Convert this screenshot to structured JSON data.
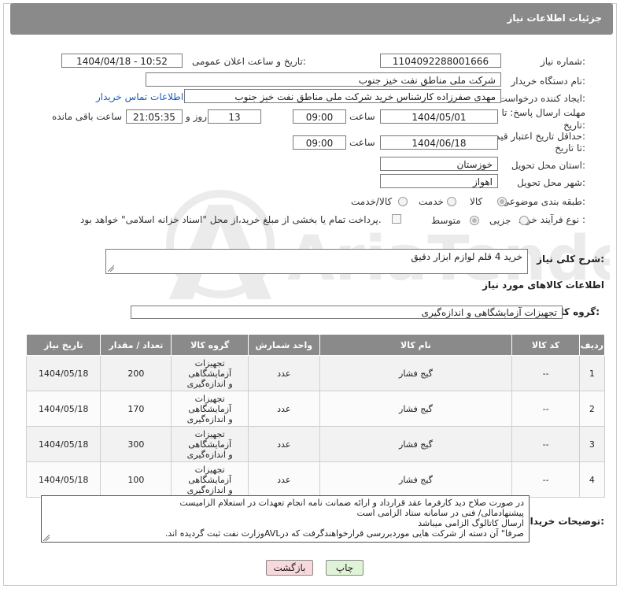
{
  "header": {
    "title": "جزئیات اطلاعات نیاز"
  },
  "fields": {
    "need_number_label": "شماره نیاز:",
    "need_number": "1104092288001666",
    "announce_label": "تاریخ و ساعت اعلان عمومی:",
    "announce_value": "1404/04/18 - 10:52",
    "buyer_org_label": "نام دستگاه خریدار:",
    "buyer_org": "شرکت ملی مناطق نفت خیز جنوب",
    "creator_label": "ایجاد کننده درخواست:",
    "creator": "مهدی صفرزاده کارشناس خرید شرکت ملی مناطق نفت خیز جنوب",
    "contact_link": "اطلاعات تماس خریدار",
    "deadline_label_1": "مهلت ارسال پاسخ: تا",
    "deadline_label_2": "تاریخ:",
    "deadline_date": "1404/05/01",
    "time_label": "ساعت",
    "deadline_time": "09:00",
    "days_value": "13",
    "days_label": "روز و",
    "remaining_time": "21:05:35",
    "remaining_label": "ساعت باقی مانده",
    "validity_label_1": "حداقل تاریخ اعتبار قیمت:",
    "validity_label_2": "تا تاریخ:",
    "validity_date": "1404/06/18",
    "validity_time": "09:00",
    "province_label": "استان محل تحویل:",
    "province": "خوزستان",
    "city_label": "شهر محل تحویل:",
    "city": "اهواز",
    "category_label": "طبقه بندی موضوعی:",
    "category_options": [
      "کالا",
      "خدمت",
      "کالا/خدمت"
    ],
    "process_label": "نوع فرآیند خرید :",
    "process_options": [
      "جزیی",
      "متوسط"
    ],
    "payment_note": "پرداخت تمام یا بخشی از مبلغ خرید،از محل \"اسناد خزانه اسلامی\" خواهد بود.",
    "description_label": "شرح کلی نیاز:",
    "description": "خرید 4 قلم لوازم ابزار دقیق",
    "goods_info_title": "اطلاعات کالاهای مورد نیاز",
    "goods_group_label": "گروه کالا:",
    "goods_group": "تجهیزات آزمایشگاهی و اندازه‌گیری"
  },
  "table": {
    "headers": [
      "ردیف",
      "کد کالا",
      "نام کالا",
      "واحد شمارش",
      "گروه کالا",
      "تعداد / مقدار",
      "تاریخ نیاز"
    ],
    "rows": [
      [
        "1",
        "--",
        "گیج فشار",
        "عدد",
        "تجهیزات آزمایشگاهی و اندازه‌گیری",
        "200",
        "1404/05/18"
      ],
      [
        "2",
        "--",
        "گیج فشار",
        "عدد",
        "تجهیزات آزمایشگاهی و اندازه‌گیری",
        "170",
        "1404/05/18"
      ],
      [
        "3",
        "--",
        "گیج فشار",
        "عدد",
        "تجهیزات آزمایشگاهی و اندازه‌گیری",
        "300",
        "1404/05/18"
      ],
      [
        "4",
        "--",
        "گیج فشار",
        "عدد",
        "تجهیزات آزمایشگاهی و اندازه‌گیری",
        "100",
        "1404/05/18"
      ]
    ]
  },
  "buyer_notes": {
    "label": "توضیحات خریدار:",
    "lines": [
      "در صورت صلاح دید کارفرما عقد قرارداد و ارائه ضمانت نامه انجام تعهدات در استعلام الزامیست",
      "پیشنهادمالی/ فنی در سامانه ستاد الزامی است",
      "ارسال کاتالوگ الزامی میباشد",
      "صرفا\" آن دسته از شرکت هایی موردبررسی قرارخواهندگرفت که درAVLوزارت نفت ثبت گردیده اند."
    ]
  },
  "buttons": {
    "print": "چاپ",
    "back": "بازگشت"
  },
  "watermark": {
    "text": "AriaTender.net"
  },
  "colors": {
    "header_bg": "#8a8a8a",
    "link": "#1a5fb4",
    "print_btn": "#dff3d7",
    "back_btn": "#f7d9dc"
  }
}
